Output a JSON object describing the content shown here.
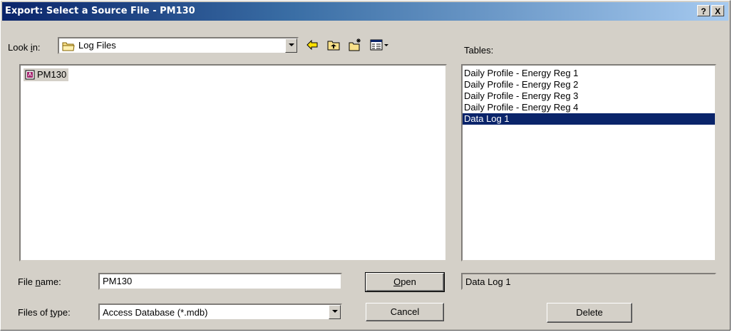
{
  "window": {
    "title": "Export: Select a Source File - PM130",
    "help_label": "?",
    "close_label": "X"
  },
  "look_in": {
    "label": "Look in:",
    "value": "Log Files"
  },
  "toolbar": {
    "icons": [
      "back-icon",
      "up-folder-icon",
      "new-folder-icon",
      "view-menu-icon"
    ]
  },
  "files": [
    {
      "name": "PM130"
    }
  ],
  "tables": {
    "label": "Tables:",
    "items": [
      "Daily Profile - Energy Reg 1",
      "Daily Profile - Energy Reg 2",
      "Daily Profile - Energy Reg 3",
      "Daily Profile - Energy Reg 4",
      "Data Log 1"
    ],
    "selected_index": 4,
    "selected_value": "Data Log 1"
  },
  "file_name": {
    "label": "File name:",
    "value": "PM130"
  },
  "file_type": {
    "label": "Files of type:",
    "value": "Access Database (*.mdb)"
  },
  "buttons": {
    "open": "Open",
    "cancel": "Cancel",
    "delete": "Delete"
  }
}
